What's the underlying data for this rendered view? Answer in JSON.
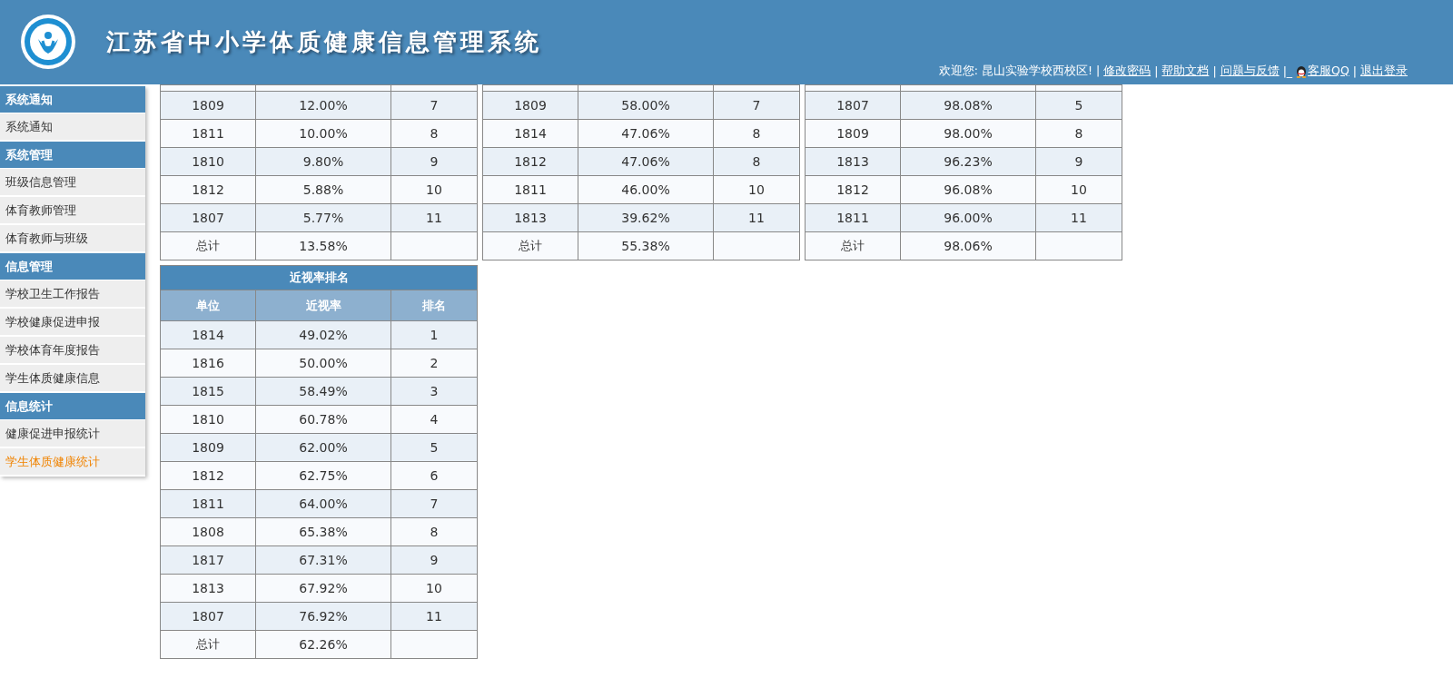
{
  "header": {
    "title": "江苏省中小学体质健康信息管理系统",
    "user_bar": [
      {
        "kind": "text",
        "text": "欢迎您: 昆山实验学校西校区! |"
      },
      {
        "kind": "link",
        "text": "修改密码"
      },
      {
        "kind": "text",
        "text": "|"
      },
      {
        "kind": "link",
        "text": "帮助文档"
      },
      {
        "kind": "text",
        "text": "|"
      },
      {
        "kind": "link",
        "text": "问题与反馈"
      },
      {
        "kind": "text",
        "text": "|_"
      },
      {
        "kind": "qq",
        "text": "客服QQ"
      },
      {
        "kind": "text",
        "text": "|"
      },
      {
        "kind": "link",
        "text": "退出登录"
      }
    ]
  },
  "sidebar": [
    {
      "title": "系统通知",
      "items": [
        {
          "label": "系统通知",
          "selected": false
        }
      ]
    },
    {
      "title": "系统管理",
      "items": [
        {
          "label": "班级信息管理",
          "selected": false
        },
        {
          "label": "体育教师管理",
          "selected": false
        },
        {
          "label": "体育教师与班级",
          "selected": false
        }
      ]
    },
    {
      "title": "信息管理",
      "items": [
        {
          "label": "学校卫生工作报告",
          "selected": false
        },
        {
          "label": "学校健康促进申报",
          "selected": false
        },
        {
          "label": "学校体育年度报告",
          "selected": false
        },
        {
          "label": "学生体质健康信息",
          "selected": false
        }
      ]
    },
    {
      "title": "信息统计",
      "items": [
        {
          "label": "健康促进申报统计",
          "selected": false
        },
        {
          "label": "学生体质健康统计",
          "selected": true
        }
      ]
    }
  ],
  "tables": [
    {
      "rows": [
        [
          "1809",
          "12.00%",
          "7"
        ],
        [
          "1811",
          "10.00%",
          "8"
        ],
        [
          "1810",
          "9.80%",
          "9"
        ],
        [
          "1812",
          "5.88%",
          "10"
        ],
        [
          "1807",
          "5.77%",
          "11"
        ]
      ],
      "total": [
        "总计",
        "13.58%"
      ]
    },
    {
      "rows": [
        [
          "1809",
          "58.00%",
          "7"
        ],
        [
          "1814",
          "47.06%",
          "8"
        ],
        [
          "1812",
          "47.06%",
          "8"
        ],
        [
          "1811",
          "46.00%",
          "10"
        ],
        [
          "1813",
          "39.62%",
          "11"
        ]
      ],
      "total": [
        "总计",
        "55.38%"
      ]
    },
    {
      "rows": [
        [
          "1807",
          "98.08%",
          "5"
        ],
        [
          "1809",
          "98.00%",
          "8"
        ],
        [
          "1813",
          "96.23%",
          "9"
        ],
        [
          "1812",
          "96.08%",
          "10"
        ],
        [
          "1811",
          "96.00%",
          "11"
        ]
      ],
      "total": [
        "总计",
        "98.06%"
      ]
    },
    {
      "title": "近视率排名",
      "columns": [
        "单位",
        "近视率",
        "排名"
      ],
      "rows": [
        [
          "1814",
          "49.02%",
          "1"
        ],
        [
          "1816",
          "50.00%",
          "2"
        ],
        [
          "1815",
          "58.49%",
          "3"
        ],
        [
          "1810",
          "60.78%",
          "4"
        ],
        [
          "1809",
          "62.00%",
          "5"
        ],
        [
          "1812",
          "62.75%",
          "6"
        ],
        [
          "1811",
          "64.00%",
          "7"
        ],
        [
          "1808",
          "65.38%",
          "8"
        ],
        [
          "1817",
          "67.31%",
          "9"
        ],
        [
          "1813",
          "67.92%",
          "10"
        ],
        [
          "1807",
          "76.92%",
          "11"
        ]
      ],
      "total": [
        "总计",
        "62.26%"
      ]
    }
  ]
}
